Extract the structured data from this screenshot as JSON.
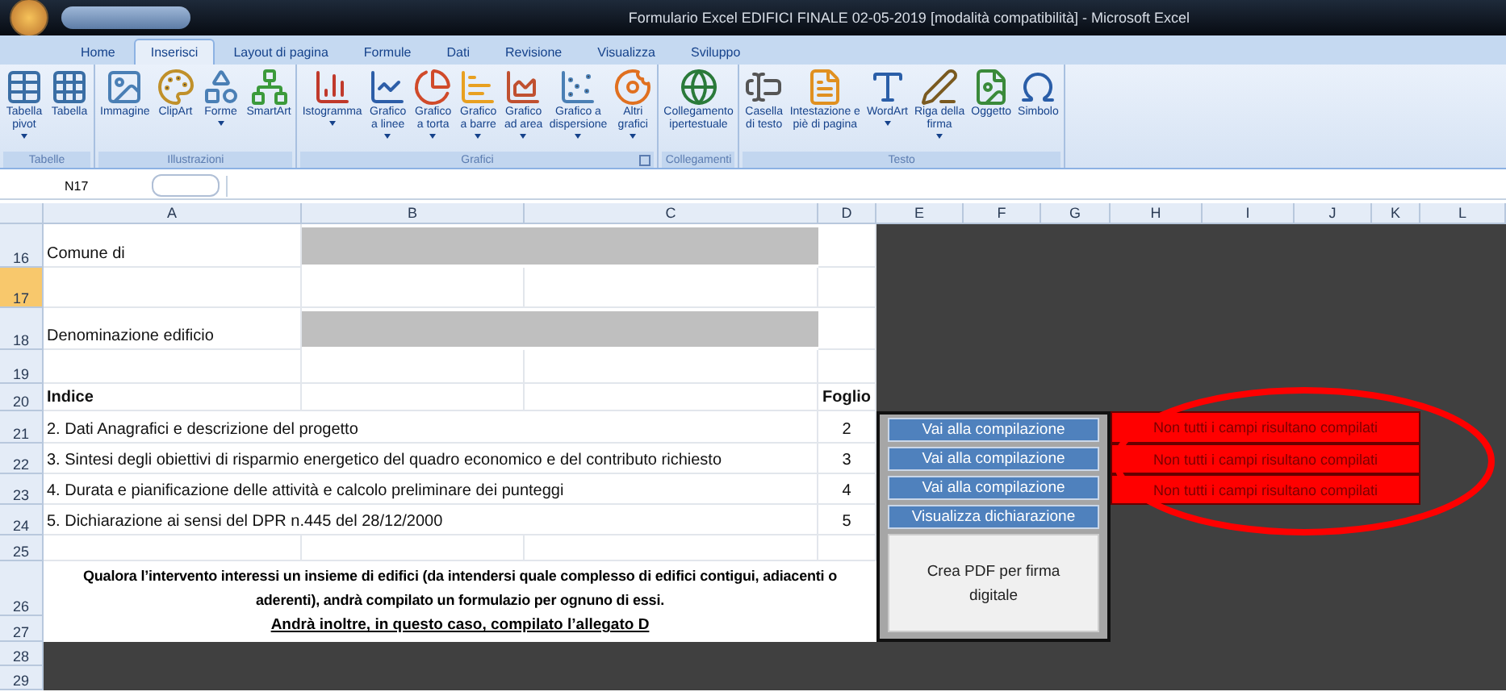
{
  "window": {
    "title": "Formulario Excel EDIFICI FINALE 02-05-2019 [modalità compatibilità] - Microsoft Excel"
  },
  "tabs": [
    {
      "label": "Home",
      "selected": false
    },
    {
      "label": "Inserisci",
      "selected": true
    },
    {
      "label": "Layout di pagina",
      "selected": false
    },
    {
      "label": "Formule",
      "selected": false
    },
    {
      "label": "Dati",
      "selected": false
    },
    {
      "label": "Revisione",
      "selected": false
    },
    {
      "label": "Visualizza",
      "selected": false
    },
    {
      "label": "Sviluppo",
      "selected": false
    }
  ],
  "ribbon": [
    {
      "label": "Tabelle",
      "launcher": false,
      "items": [
        {
          "lines": [
            "Tabella",
            "pivot"
          ],
          "dropdown": true
        },
        {
          "lines": [
            "Tabella"
          ],
          "dropdown": false
        }
      ]
    },
    {
      "label": "Illustrazioni",
      "launcher": false,
      "items": [
        {
          "lines": [
            "Immagine"
          ],
          "dropdown": false
        },
        {
          "lines": [
            "ClipArt"
          ],
          "dropdown": false
        },
        {
          "lines": [
            "Forme"
          ],
          "dropdown": true
        },
        {
          "lines": [
            "SmartArt"
          ],
          "dropdown": false
        }
      ]
    },
    {
      "label": "Grafici",
      "launcher": true,
      "items": [
        {
          "lines": [
            "Istogramma"
          ],
          "dropdown": true
        },
        {
          "lines": [
            "Grafico",
            "a linee"
          ],
          "dropdown": true
        },
        {
          "lines": [
            "Grafico",
            "a torta"
          ],
          "dropdown": true
        },
        {
          "lines": [
            "Grafico",
            "a barre"
          ],
          "dropdown": true
        },
        {
          "lines": [
            "Grafico",
            "ad area"
          ],
          "dropdown": true
        },
        {
          "lines": [
            "Grafico a",
            "dispersione"
          ],
          "dropdown": true
        },
        {
          "lines": [
            "Altri",
            "grafici"
          ],
          "dropdown": true
        }
      ]
    },
    {
      "label": "Collegamenti",
      "launcher": false,
      "items": [
        {
          "lines": [
            "Collegamento",
            "ipertestuale"
          ],
          "dropdown": false
        }
      ]
    },
    {
      "label": "Testo",
      "launcher": false,
      "items": [
        {
          "lines": [
            "Casella",
            "di testo"
          ],
          "dropdown": false
        },
        {
          "lines": [
            "Intestazione e",
            "piè di pagina"
          ],
          "dropdown": false
        },
        {
          "lines": [
            "WordArt"
          ],
          "dropdown": true
        },
        {
          "lines": [
            "Riga della",
            "firma"
          ],
          "dropdown": true
        },
        {
          "lines": [
            "Oggetto"
          ],
          "dropdown": false
        },
        {
          "lines": [
            "Simbolo"
          ],
          "dropdown": false
        }
      ]
    }
  ],
  "formula_bar": {
    "name_box": "N17"
  },
  "columns": [
    "A",
    "B",
    "C",
    "D",
    "E",
    "F",
    "G",
    "H",
    "I",
    "J",
    "K",
    "L"
  ],
  "rows": [
    {
      "number": "16",
      "selected": false
    },
    {
      "number": "17",
      "selected": true
    },
    {
      "number": "18",
      "selected": false
    },
    {
      "number": "19",
      "selected": false
    },
    {
      "number": "20",
      "selected": false
    },
    {
      "number": "21",
      "selected": false
    },
    {
      "number": "22",
      "selected": false
    },
    {
      "number": "23",
      "selected": false
    },
    {
      "number": "24",
      "selected": false
    },
    {
      "number": "25",
      "selected": false
    },
    {
      "number": "26",
      "selected": false
    },
    {
      "number": "27",
      "selected": false
    },
    {
      "number": "28",
      "selected": false
    },
    {
      "number": "29",
      "selected": false
    }
  ],
  "fields": [
    {
      "label": "Comune di"
    },
    {
      "label": "Denominazione edificio"
    }
  ],
  "index": {
    "title": "Indice",
    "sheet_heading": "Foglio",
    "entries": [
      {
        "text": "2. Dati Anagrafici e descrizione del progetto",
        "sheet": "2"
      },
      {
        "text": "3. Sintesi degli obiettivi di risparmio energetico del quadro economico e del contributo richiesto",
        "sheet": "3"
      },
      {
        "text": "4. Durata e pianificazione delle attività e calcolo preliminare dei punteggi",
        "sheet": "4"
      },
      {
        "text": "5. Dichiarazione ai sensi del DPR n.445 del 28/12/2000",
        "sheet": "5"
      }
    ]
  },
  "note": "Qualora l’intervento interessi un insieme di edifici (da intendersi quale complesso di edifici contigui, adiacenti o aderenti), andrà compilato un formulazio per ognuno di essi.",
  "note_link": "Andrà inoltre, in questo caso, compilato l’allegato D",
  "actions": [
    {
      "label": "Vai alla compilazione"
    },
    {
      "label": "Vai alla compilazione"
    },
    {
      "label": "Vai alla compilazione"
    },
    {
      "label": "Visualizza dichiarazione"
    }
  ],
  "pdf_button": "Crea PDF per firma digitale",
  "statuses": [
    {
      "text": "Non tutti i campi risultano compilati"
    },
    {
      "text": "Non tutti i campi risultano compilati"
    },
    {
      "text": "Non tutti i campi risultano compilati"
    }
  ],
  "annotation": {
    "shown": true
  }
}
